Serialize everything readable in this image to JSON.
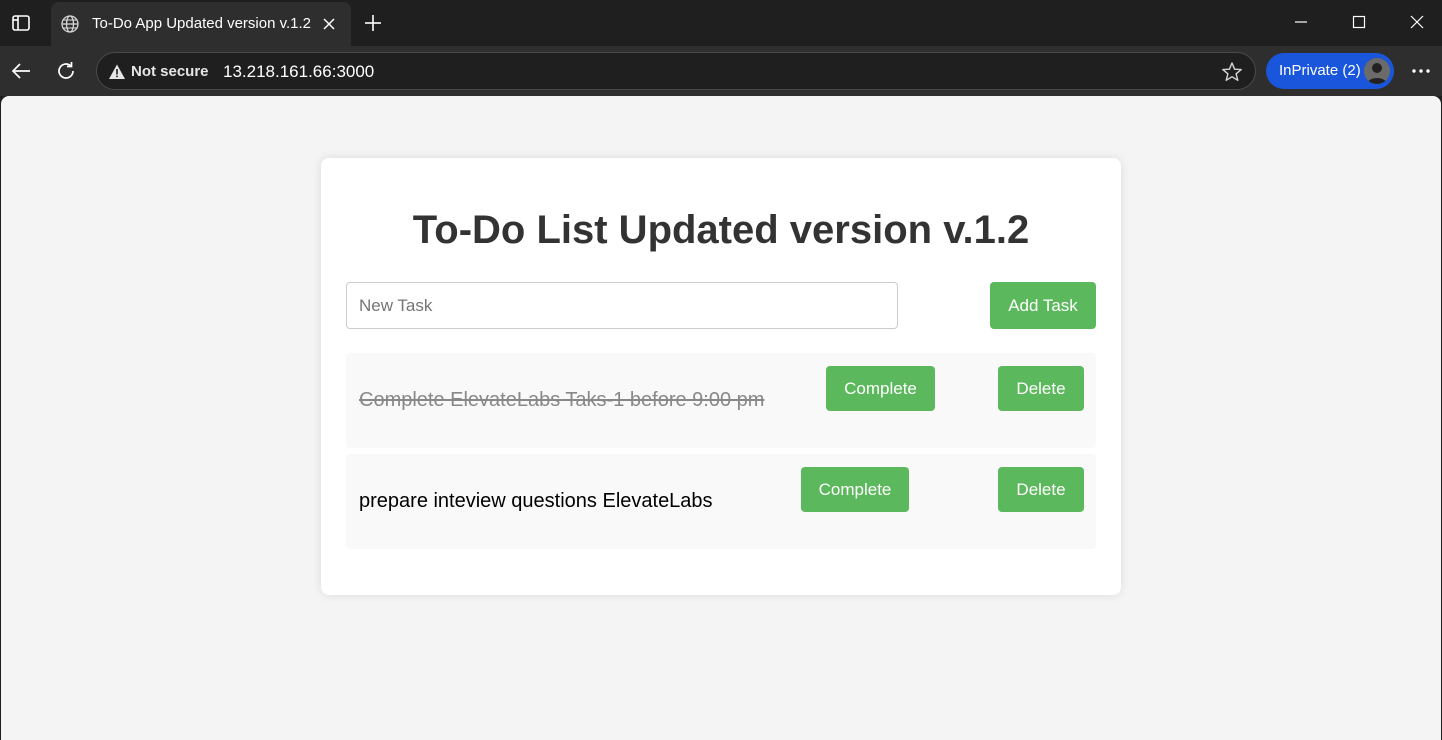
{
  "browser": {
    "tab": {
      "title": "To-Do App Updated version v.1.2"
    },
    "address_bar": {
      "security_label": "Not secure",
      "url": "13.218.161.66:3000"
    },
    "profile": {
      "label": "InPrivate (2)"
    }
  },
  "app": {
    "heading": "To-Do List Updated version v.1.2",
    "new_task": {
      "placeholder": "New Task",
      "value": ""
    },
    "add_button_label": "Add Task",
    "tasks": [
      {
        "text": "Complete ElevateLabs Taks-1 before 9:00 pm",
        "completed": true,
        "complete_label": "Complete",
        "delete_label": "Delete"
      },
      {
        "text": "prepare inteview questions ElevateLabs",
        "completed": false,
        "complete_label": "Complete",
        "delete_label": "Delete"
      }
    ]
  },
  "colors": {
    "accent_green": "#5cb85c",
    "inprivate_blue": "#1a56db",
    "page_background": "#f4f4f4"
  },
  "icons": [
    "tab-actions-icon",
    "globe-icon",
    "close-icon",
    "plus-icon",
    "minimize-icon",
    "maximize-icon",
    "window-close-icon",
    "back-icon",
    "refresh-icon",
    "warning-icon",
    "star-icon",
    "avatar",
    "more-icon"
  ]
}
